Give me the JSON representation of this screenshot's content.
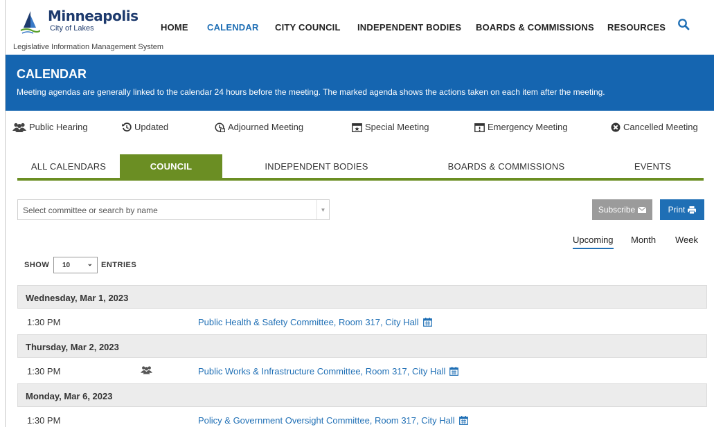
{
  "header": {
    "brand_title": "Minneapolis",
    "brand_subtitle": "City of Lakes",
    "system_name": "Legislative Information Management System",
    "nav": [
      "HOME",
      "CALENDAR",
      "CITY COUNCIL",
      "INDEPENDENT BODIES",
      "BOARDS & COMMISSIONS",
      "RESOURCES"
    ],
    "active_nav": "CALENDAR",
    "search_icon": "search-icon"
  },
  "banner": {
    "title": "CALENDAR",
    "text": "Meeting agendas are generally linked to the calendar 24 hours before the meeting. The marked agenda shows the actions taken on each item after the meeting."
  },
  "legend": [
    {
      "icon": "public-hearing-icon",
      "label": "Public Hearing"
    },
    {
      "icon": "updated-icon",
      "label": "Updated"
    },
    {
      "icon": "adjourned-icon",
      "label": "Adjourned Meeting"
    },
    {
      "icon": "special-meeting-icon",
      "label": "Special Meeting"
    },
    {
      "icon": "emergency-meeting-icon",
      "label": "Emergency Meeting"
    },
    {
      "icon": "cancelled-icon",
      "label": "Cancelled Meeting"
    }
  ],
  "tabs": [
    "ALL CALENDARS",
    "COUNCIL",
    "INDEPENDENT BODIES",
    "BOARDS & COMMISSIONS",
    "EVENTS"
  ],
  "active_tab": "COUNCIL",
  "search": {
    "placeholder": "Select committee or search by name"
  },
  "buttons": {
    "subscribe": "Subscribe",
    "print": "Print"
  },
  "views": [
    "Upcoming",
    "Month",
    "Week"
  ],
  "active_view": "Upcoming",
  "entries": {
    "show": "SHOW",
    "value": "10",
    "label": "ENTRIES"
  },
  "days": [
    {
      "date": "Wednesday, Mar 1, 2023",
      "events": [
        {
          "time": "1:30 PM",
          "title": "Public Health & Safety Committee, Room 317, City Hall",
          "public_hearing": false
        }
      ]
    },
    {
      "date": "Thursday, Mar 2, 2023",
      "events": [
        {
          "time": "1:30 PM",
          "title": "Public Works & Infrastructure Committee, Room 317, City Hall",
          "public_hearing": true
        }
      ]
    },
    {
      "date": "Monday, Mar 6, 2023",
      "events": [
        {
          "time": "1:30 PM",
          "title": "Policy & Government Oversight Committee, Room 317, City Hall",
          "public_hearing": false
        }
      ]
    }
  ],
  "colors": {
    "brand_blue": "#1565b0",
    "link_blue": "#1f6fb5",
    "tab_green": "#6b8e23",
    "subscribe_gray": "#9b9b9b"
  }
}
